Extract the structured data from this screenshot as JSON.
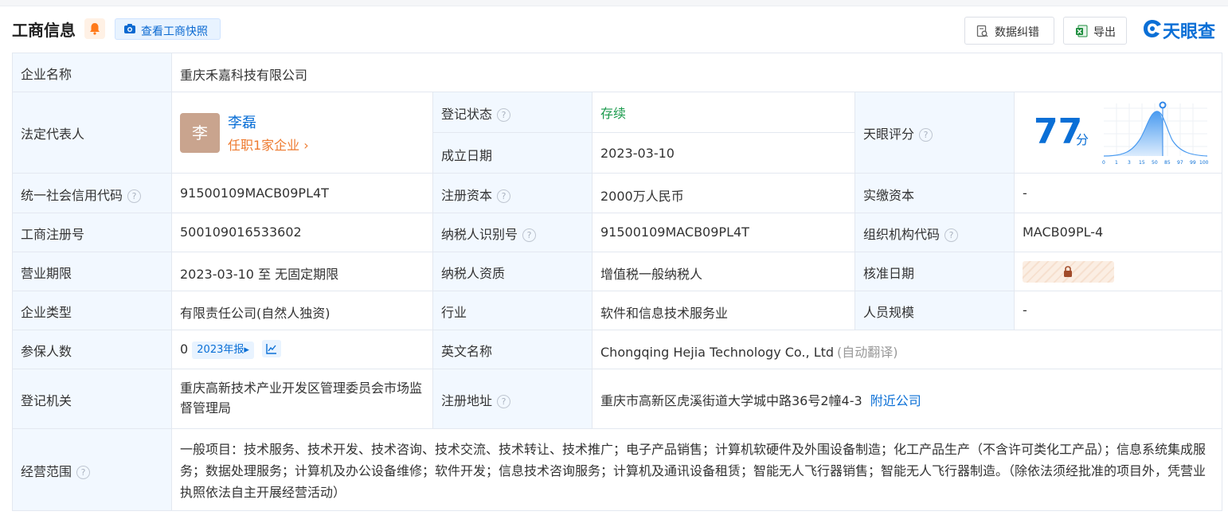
{
  "header": {
    "title": "工商信息",
    "snapshot_label": "查看工商快照",
    "error_label": "数据纠错",
    "export_label": "导出",
    "logo_text": "天眼查"
  },
  "colors": {
    "accent": "#0a6fd6",
    "label_bg": "#f2f8ff",
    "status_green": "#1a9a4c",
    "link_orange": "#ee7a2f"
  },
  "company": {
    "name_label": "企业名称",
    "name": "重庆禾嘉科技有限公司",
    "rep_label": "法定代表人",
    "rep_avatar": "李",
    "rep_name": "李磊",
    "rep_link": "任职1家企业",
    "status_label": "登记状态",
    "status": "存续",
    "founded_label": "成立日期",
    "founded": "2023-03-10",
    "score_label": "天眼评分",
    "score": "77",
    "score_unit": "分",
    "score_ticks": [
      "0",
      "1",
      "3",
      "15",
      "50",
      "85",
      "97",
      "99",
      "100"
    ],
    "credit_label": "统一社会信用代码",
    "credit_code": "91500109MACB09PL4T",
    "capital_label": "注册资本",
    "capital": "2000万人民币",
    "paid_label": "实缴资本",
    "paid": "-",
    "reg_no_label": "工商注册号",
    "reg_no": "500109016533602",
    "tax_id_label": "纳税人识别号",
    "tax_id": "91500109MACB09PL4T",
    "org_code_label": "组织机构代码",
    "org_code": "MACB09PL-4",
    "term_label": "营业期限",
    "term": "2023-03-10 至 无固定期限",
    "tax_qual_label": "纳税人资质",
    "tax_qual": "增值税一般纳税人",
    "approve_label": "核准日期",
    "type_label": "企业类型",
    "type": "有限责任公司(自然人独资)",
    "industry_label": "行业",
    "industry": "软件和信息技术服务业",
    "staff_label": "人员规模",
    "staff": "-",
    "insured_label": "参保人数",
    "insured": "0",
    "insured_badge": "2023年报",
    "en_name_label": "英文名称",
    "en_name": "Chongqing Hejia Technology Co., Ltd",
    "en_name_note": "(自动翻译)",
    "authority_label": "登记机关",
    "authority": "重庆高新技术产业开发区管理委员会市场监督管理局",
    "address_label": "注册地址",
    "address": "重庆市高新区虎溪街道大学城中路36号2幢4-3",
    "nearby_label": "附近公司",
    "scope_label": "经营范围",
    "scope": "一般项目：技术服务、技术开发、技术咨询、技术交流、技术转让、技术推广；电子产品销售；计算机软硬件及外围设备制造；化工产品生产（不含许可类化工产品）；信息系统集成服务；数据处理服务；计算机及办公设备维修；软件开发；信息技术咨询服务；计算机及通讯设备租赁；智能无人飞行器销售；智能无人飞行器制造。（除依法须经批准的项目外，凭营业执照依法自主开展经营活动）"
  }
}
